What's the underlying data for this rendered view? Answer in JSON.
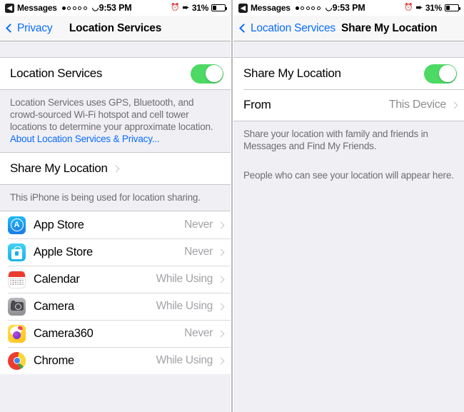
{
  "status_bar": {
    "back_app": "Messages",
    "back_icon": "back-arrow-badge-icon",
    "signal_dots_filled": 1,
    "signal_dots_total": 5,
    "wifi_icon": "wifi-icon",
    "time": "9:53 PM",
    "alarm_icon": "alarm-clock-icon",
    "location_icon": "location-arrow-icon",
    "battery_percent": "31%",
    "battery_level": 31
  },
  "colors": {
    "toggle_on": "#4cd964",
    "link_blue": "#0a6cff",
    "value_gray": "#8e8e93",
    "group_bg": "#efeff4"
  },
  "left_panel": {
    "nav": {
      "back_label": "Privacy",
      "title": "Location Services"
    },
    "master_row": {
      "label": "Location Services",
      "toggle_on": true
    },
    "master_footer": {
      "text": "Location Services uses GPS, Bluetooth, and crowd-sourced Wi-Fi hotspot and cell tower locations to determine your approximate location. ",
      "link": "About Location Services & Privacy..."
    },
    "share_row": {
      "label": "Share My Location",
      "chevron": "chevron-right-icon"
    },
    "share_footer": "This iPhone is being used for location sharing.",
    "apps": [
      {
        "name": "App Store",
        "value": "Never",
        "icon": "app-store-icon"
      },
      {
        "name": "Apple Store",
        "value": "Never",
        "icon": "apple-store-icon"
      },
      {
        "name": "Calendar",
        "value": "While Using",
        "icon": "calendar-icon"
      },
      {
        "name": "Camera",
        "value": "While Using",
        "icon": "camera-icon"
      },
      {
        "name": "Camera360",
        "value": "Never",
        "icon": "camera360-icon"
      },
      {
        "name": "Chrome",
        "value": "While Using",
        "icon": "chrome-icon"
      }
    ]
  },
  "right_panel": {
    "nav": {
      "back_label": "Location Services",
      "title": "Share My Location"
    },
    "share_row": {
      "label": "Share My Location",
      "toggle_on": true
    },
    "from_row": {
      "label": "From",
      "value": "This Device",
      "chevron": "chevron-right-icon"
    },
    "footer_one": "Share your location with family and friends in Messages and Find My Friends.",
    "footer_two": "People who can see your location will appear here."
  }
}
